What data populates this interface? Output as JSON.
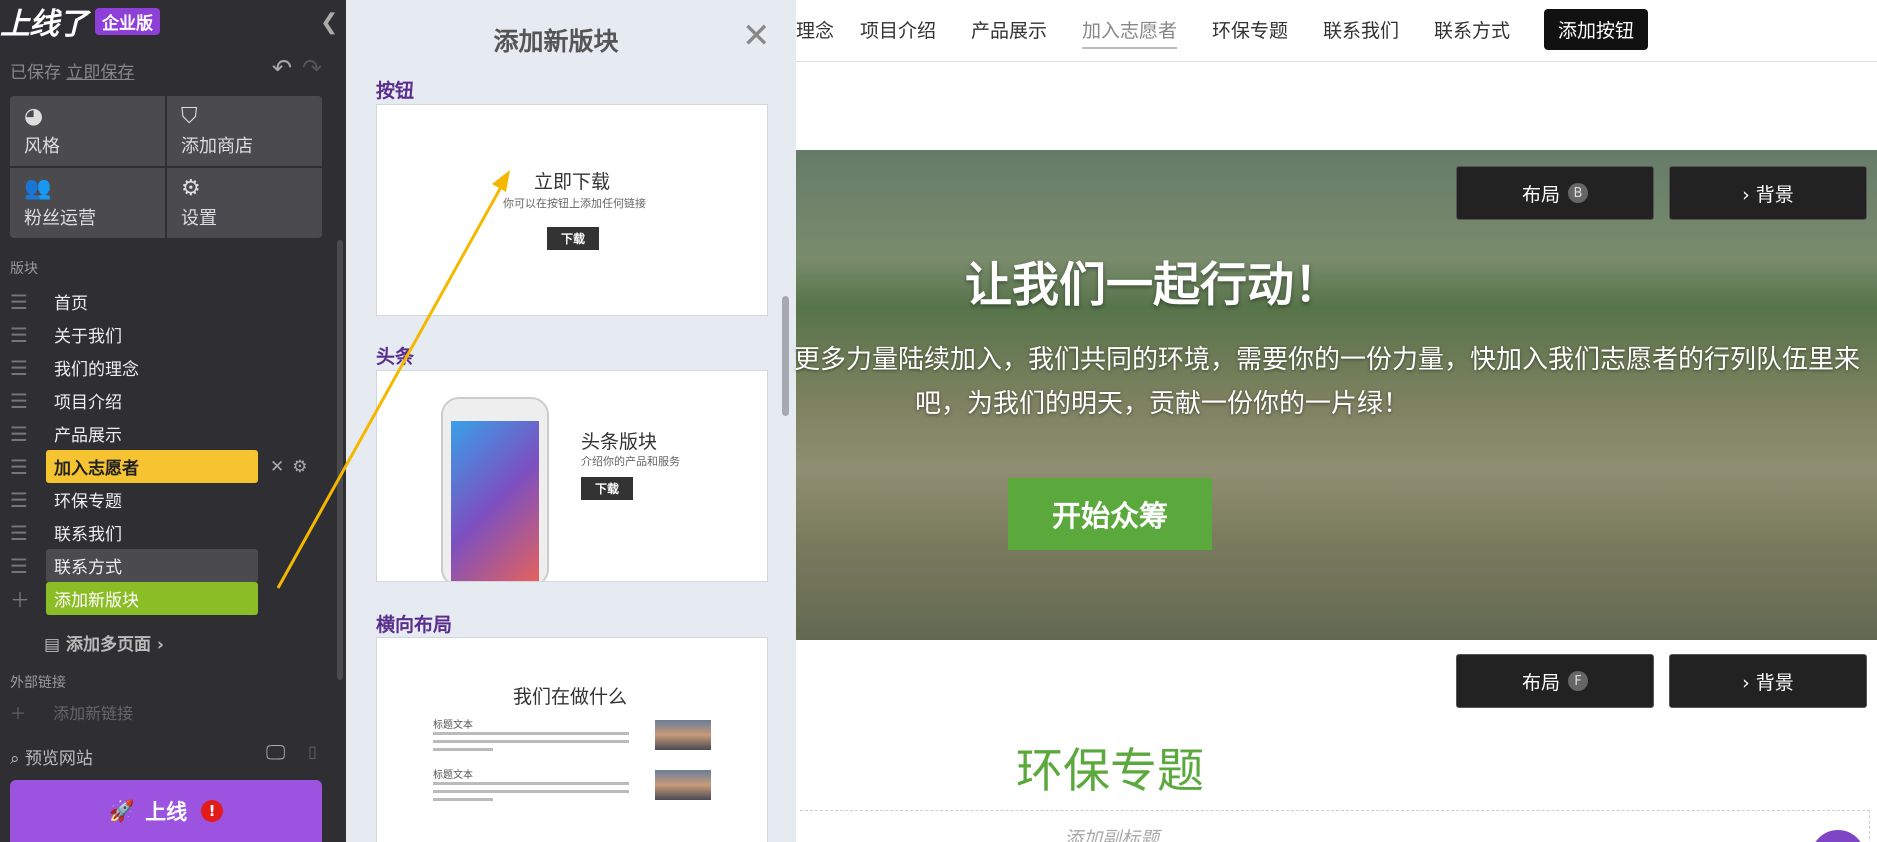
{
  "sidebar": {
    "brand": "上线了",
    "edition": "企业版",
    "saved_status": "已保存",
    "save_now": "立即保存",
    "tools": [
      {
        "label": "风格",
        "icon": "palette-icon"
      },
      {
        "label": "添加商店",
        "icon": "shop-bag-icon"
      },
      {
        "label": "粉丝运营",
        "icon": "users-icon"
      },
      {
        "label": "设置",
        "icon": "gear-icon"
      }
    ],
    "blocks_label": "版块",
    "blocks": [
      {
        "label": "首页",
        "state": "normal"
      },
      {
        "label": "关于我们",
        "state": "normal"
      },
      {
        "label": "我们的理念",
        "state": "normal"
      },
      {
        "label": "项目介绍",
        "state": "normal"
      },
      {
        "label": "产品展示",
        "state": "normal"
      },
      {
        "label": "加入志愿者",
        "state": "active"
      },
      {
        "label": "环保专题",
        "state": "normal"
      },
      {
        "label": "联系我们",
        "state": "normal"
      },
      {
        "label": "联系方式",
        "state": "hover"
      },
      {
        "label": "添加新版块",
        "state": "add"
      }
    ],
    "add_multipage": "添加多页面",
    "external_links_label": "外部链接",
    "add_new_link": "添加新链接",
    "preview_site": "预览网站",
    "go_live": "上线",
    "warn_mark": "!"
  },
  "panel": {
    "title": "添加新版块",
    "categories": {
      "button": {
        "label": "按钮",
        "title": "立即下载",
        "subtitle": "你可以在按钮上添加任何链接",
        "button": "下载"
      },
      "headline": {
        "label": "头条",
        "title": "头条版块",
        "subtitle": "介绍你的产品和服务",
        "button": "下载"
      },
      "horizontal": {
        "label": "横向布局",
        "title": "我们在做什么",
        "item1": "标题文本",
        "item2": "标题文本"
      }
    }
  },
  "site": {
    "nav": [
      "理念",
      "项目介绍",
      "产品展示",
      "加入志愿者",
      "环保专题",
      "联系我们",
      "联系方式"
    ],
    "nav_add_button": "添加按钮",
    "layout_label": "布局",
    "layout_key_b": "B",
    "layout_key_f": "F",
    "background_label": "› 背景",
    "hero_title": "让我们一起行动！",
    "hero_desc_line1": "更多力量陆续加入，我们共同的环境，需要你的一份力量，快加入我们志愿者的行列队伍里来",
    "hero_desc_line2": "吧，为我们的明天，贡献一份你的一片绿！",
    "hero_cta": "开始众筹",
    "section_title": "环保专题",
    "subtitle_placeholder": "添加副标题"
  },
  "colors": {
    "accent_purple": "#8e3fd8",
    "active_block": "#f6c431",
    "add_block": "#8bbe26",
    "green": "#5ba93d"
  }
}
